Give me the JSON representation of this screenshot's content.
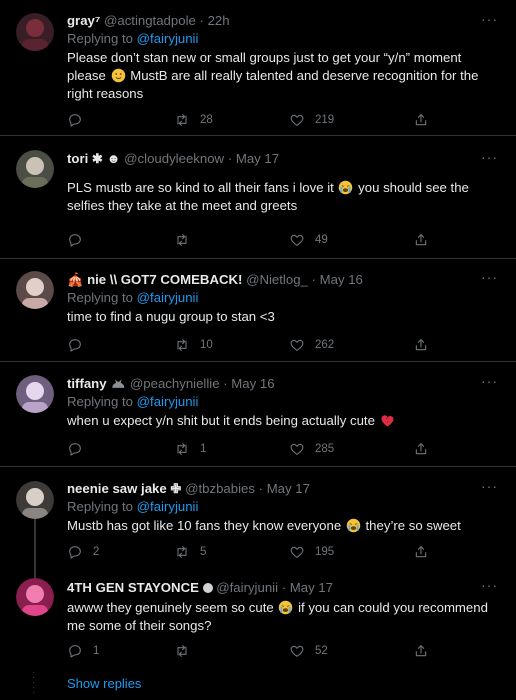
{
  "tweets": [
    {
      "name": "gray⁷",
      "handle": "@actingtadpole",
      "dot": "·",
      "time": "22h",
      "reply_prefix": "Replying to ",
      "reply_to": "@fairyjunii",
      "text_a": "Please don’t stan new or small groups just to get your “y/n” moment please",
      "text_b": "MustB are all really talented and deserve recognition for the right reasons",
      "replies": "",
      "retweets": "28",
      "likes": "219",
      "avatar_color": "#7a2d3b"
    },
    {
      "name": "tori ✱ ☻",
      "handle": "@cloudyleeknow",
      "dot": "·",
      "time": "May 17",
      "text_a": "PLS mustb are so kind to all their fans i love it",
      "text_b": "you should see the selfies they take at the meet and greets",
      "replies": "",
      "retweets": "",
      "likes": "49",
      "avatar_color": "#6b6f5a"
    },
    {
      "name": "🎪 nie \\\\ GOT7 COMEBACK!",
      "handle": "@Nietlog_",
      "dot": "·",
      "time": "May 16",
      "reply_prefix": "Replying to ",
      "reply_to": "@fairyjunii",
      "text_a": "time to find a nugu group to stan <3",
      "replies": "",
      "retweets": "10",
      "likes": "262",
      "avatar_color": "#c9a9a6"
    },
    {
      "name": "tiffany",
      "handle": "@peachyniellie",
      "dot": "·",
      "time": "May 16",
      "reply_prefix": "Replying to ",
      "reply_to": "@fairyjunii",
      "text_a": "when u expect y/n shit but it ends being actually cute",
      "replies": "",
      "retweets": "1",
      "likes": "285",
      "avatar_color": "#b9a3c9"
    },
    {
      "name": "neenie saw jake ✙",
      "handle": "@tbzbabies",
      "dot": "·",
      "time": "May 17",
      "reply_prefix": "Replying to ",
      "reply_to": "@fairyjunii",
      "text_a": "Mustb has got like 10 fans they know everyone",
      "text_b": "they’re so sweet",
      "replies": "2",
      "retweets": "5",
      "likes": "195",
      "avatar_color": "#8a8580"
    },
    {
      "name": "4TH GEN STAYONCE",
      "handle": "@fairyjunii",
      "dot": "·",
      "time": "May 17",
      "text_a": "awww they genuinely seem so cute",
      "text_b": "if you can could you recommend me some of their songs?",
      "replies": "1",
      "retweets": "",
      "likes": "52",
      "avatar_color": "#e0458a"
    }
  ],
  "show_replies": "Show replies",
  "colors": {
    "background": "#000000",
    "accent": "#1d9bf0",
    "muted": "#71767b",
    "text": "#e7e9ea",
    "divider": "#2f3336"
  }
}
